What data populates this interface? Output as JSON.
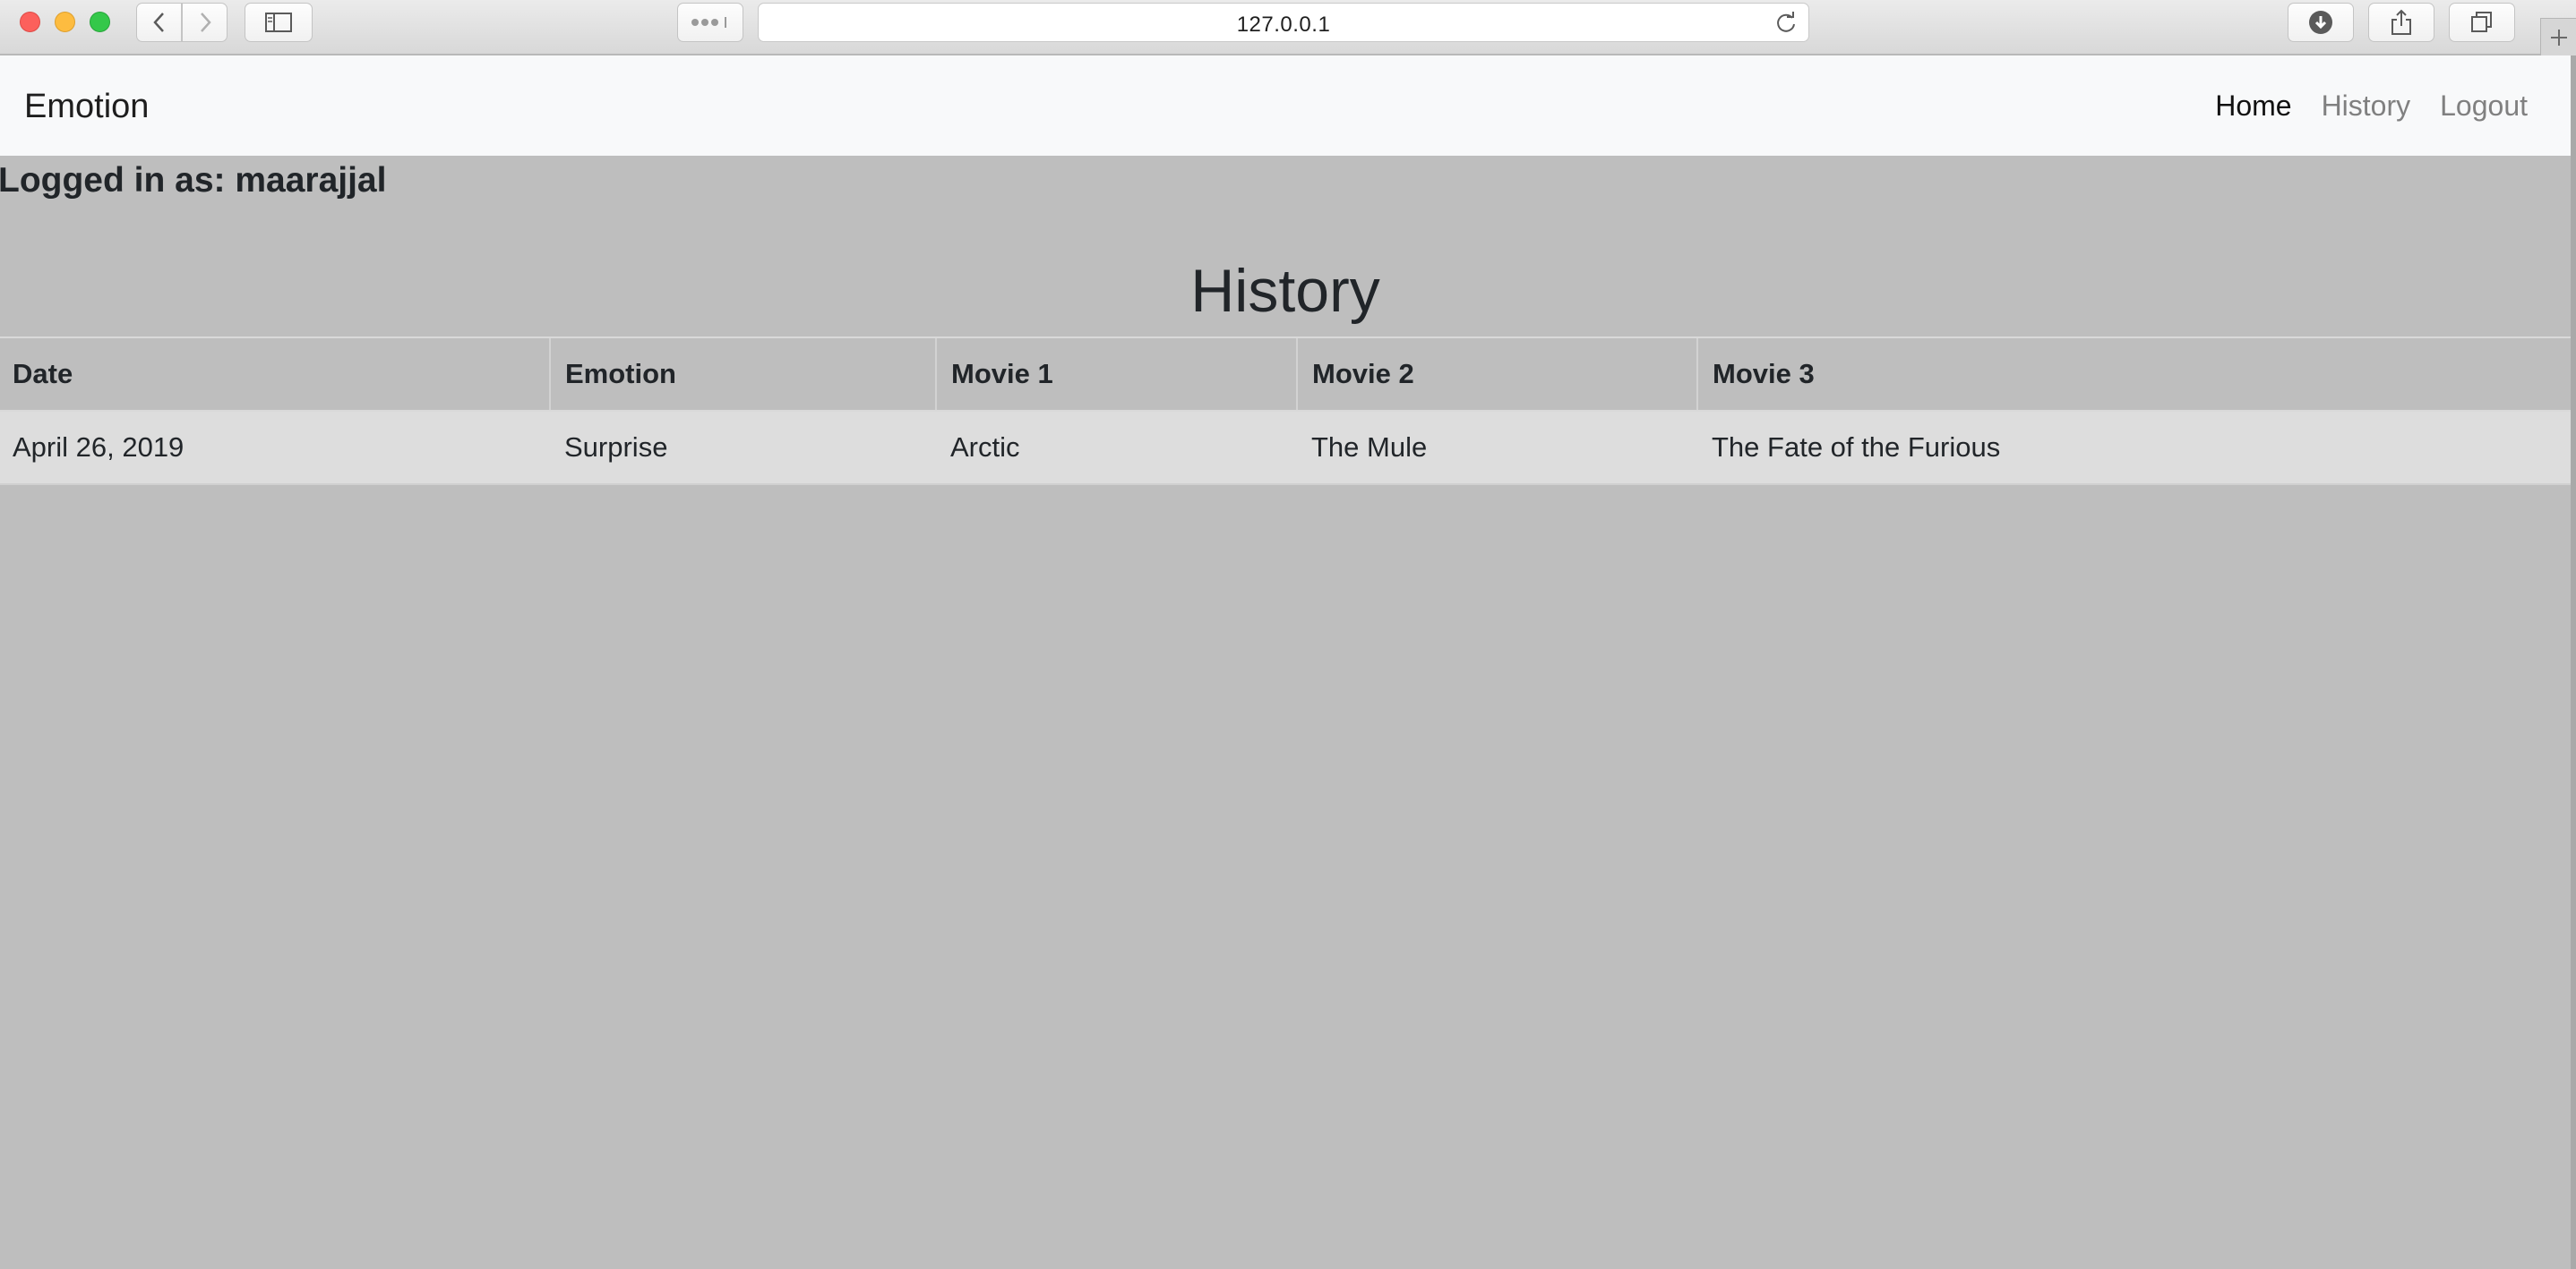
{
  "browser": {
    "url": "127.0.0.1"
  },
  "navbar": {
    "brand": "Emotion",
    "links": [
      {
        "label": "Home",
        "active": true
      },
      {
        "label": "History",
        "active": false
      },
      {
        "label": "Logout",
        "active": false
      }
    ]
  },
  "user": {
    "logged_in_text": "Logged in as: maarajjal"
  },
  "page": {
    "title": "History"
  },
  "table": {
    "headers": [
      "Date",
      "Emotion",
      "Movie 1",
      "Movie 2",
      "Movie 3"
    ],
    "rows": [
      [
        "April 26, 2019",
        "Surprise",
        "Arctic",
        "The Mule",
        "The Fate of the Furious"
      ]
    ]
  },
  "colors": {
    "page_background": "#bebebe",
    "navbar_background": "#f8f9fa",
    "row_background": "#dddddd",
    "active_link": "#111111",
    "inactive_link": "#808080"
  },
  "icons": {
    "back": "chevron-left-icon",
    "forward": "chevron-right-icon",
    "sidebar": "sidebar-icon",
    "reader": "reader-icon",
    "reload": "reload-icon",
    "download": "download-icon",
    "share": "share-icon",
    "tabs": "tabs-icon",
    "new_tab": "plus-icon"
  }
}
